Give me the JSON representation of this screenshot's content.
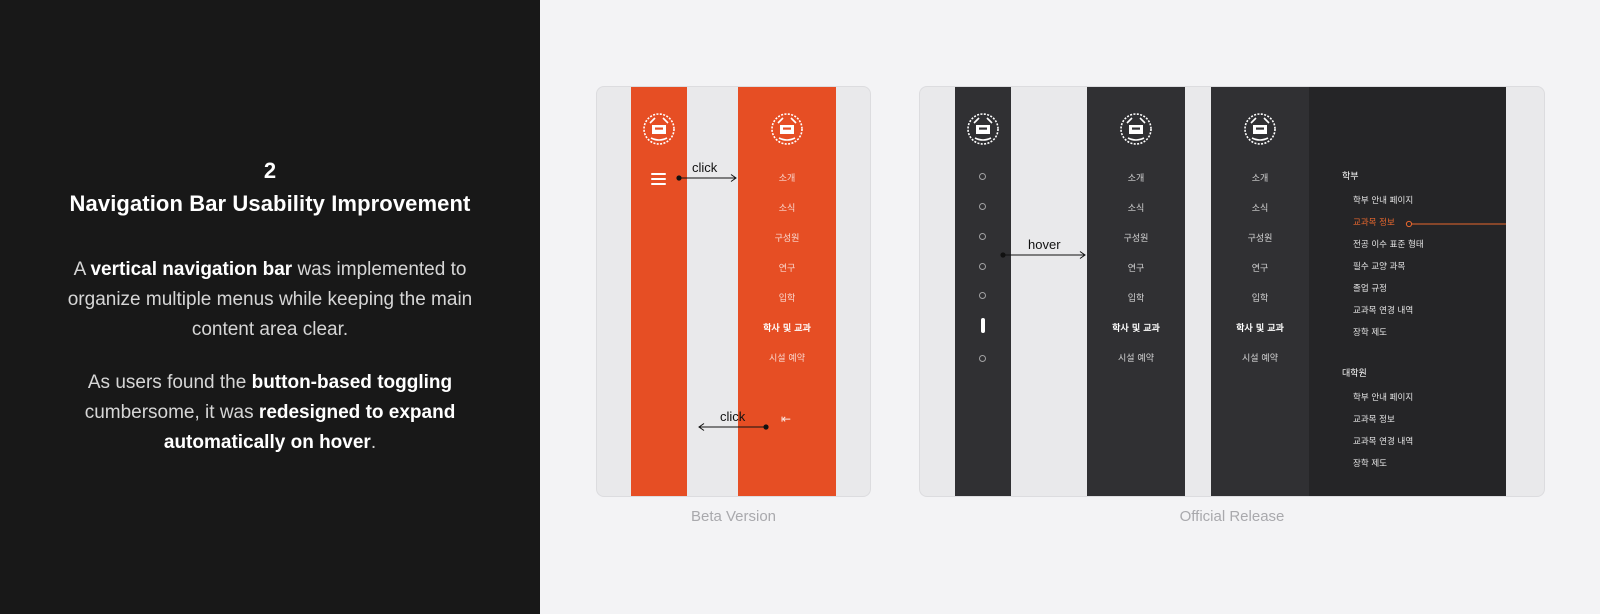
{
  "text_panel": {
    "section_number": "2",
    "title": "Navigation Bar Usability Improvement",
    "paragraph_1": [
      {
        "text": "A ",
        "bold": false
      },
      {
        "text": "vertical navigation bar",
        "bold": true
      },
      {
        "text": " was implemented to organize multiple menus while keeping the main content area clear.",
        "bold": false
      }
    ],
    "paragraph_2": [
      {
        "text": "As users found the ",
        "bold": false
      },
      {
        "text": "button-based toggling",
        "bold": true
      },
      {
        "text": " cumbersome, it was ",
        "bold": false
      },
      {
        "text": "redesigned to expand automatically on hover",
        "bold": true
      },
      {
        "text": ".",
        "bold": false
      }
    ]
  },
  "beta": {
    "caption": "Beta Version",
    "annotation_open": "click",
    "annotation_close": "click",
    "menu_items": [
      "소개",
      "소식",
      "구성원",
      "연구",
      "입학",
      "학사 및 교과",
      "시설 예약"
    ],
    "active_index": 5,
    "icons": [
      "university-logo-icon",
      "hamburger-menu-icon",
      "collapse-sidebar-icon"
    ]
  },
  "official": {
    "caption": "Official Release",
    "annotation_hover": "hover",
    "menu_items": [
      "소개",
      "소식",
      "구성원",
      "연구",
      "입학",
      "학사 및 교과",
      "시설 예약"
    ],
    "active_index": 5,
    "submenu_undergrad_title": "학부",
    "submenu_undergrad_items": [
      "학부 안내 페이지",
      "교과목 정보",
      "전공 이수 표준 형태",
      "필수 교양 과목",
      "졸업 규정",
      "교과목 연경 내역",
      "장학 제도"
    ],
    "submenu_undergrad_active": 1,
    "submenu_grad_title": "대학원",
    "submenu_grad_items": [
      "학부 안내 페이지",
      "교과목 정보",
      "교과목 연경 내역",
      "장학 제도"
    ]
  },
  "colors": {
    "beta_accent": "#e64e24",
    "official_bar": "#303033",
    "official_submenu_bar": "#252527",
    "submenu_active": "#e8672e",
    "panel_bg": "#181818"
  }
}
